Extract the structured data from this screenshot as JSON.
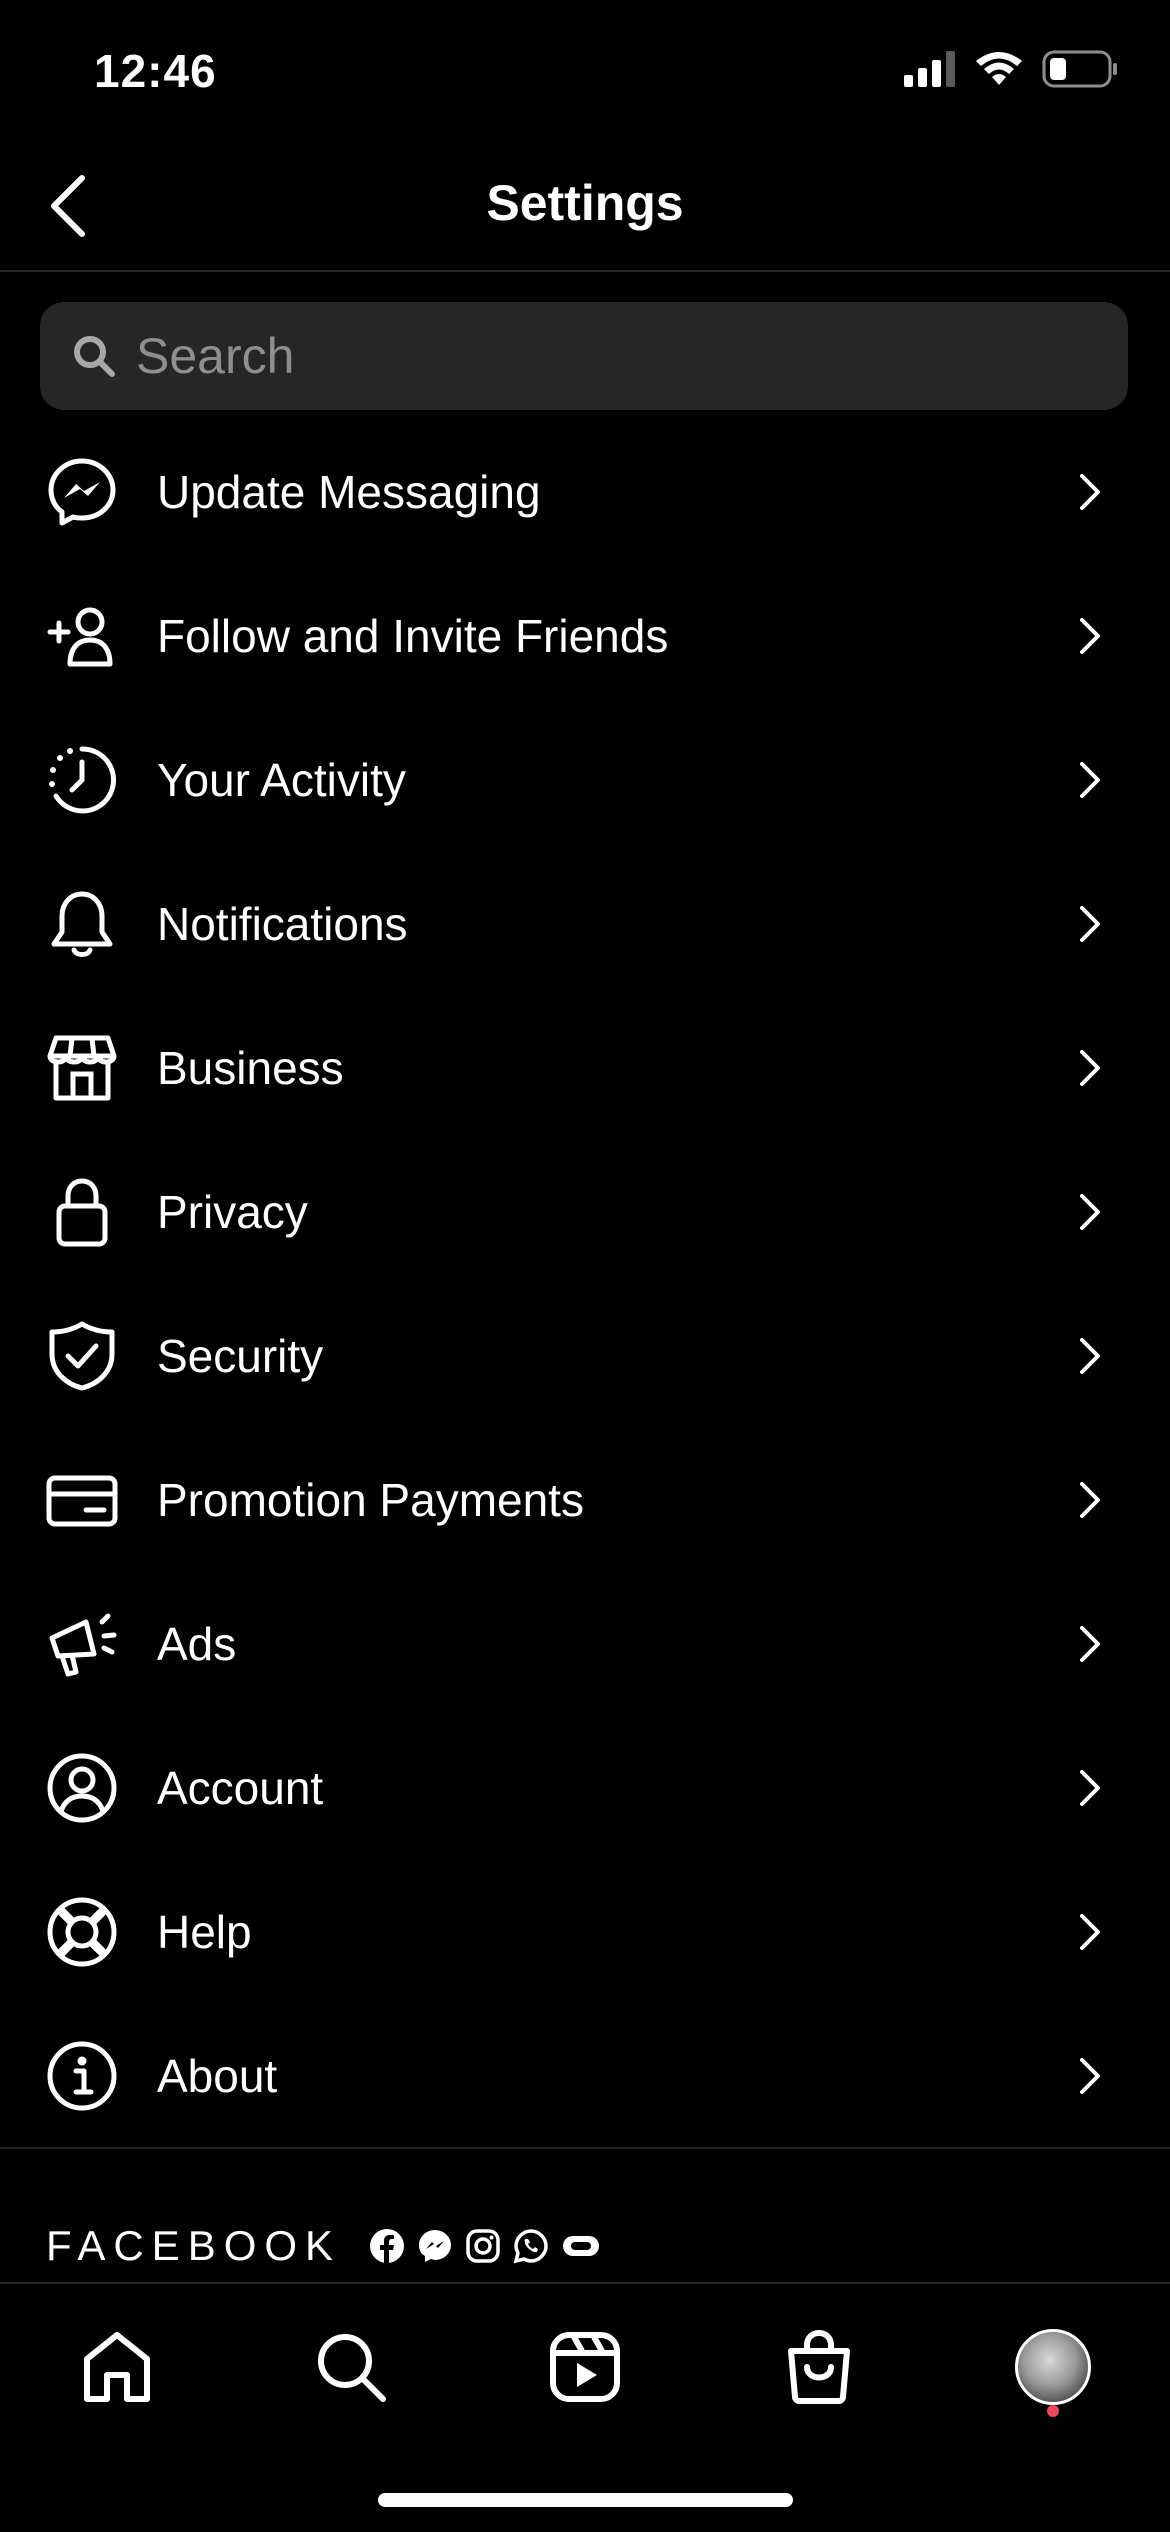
{
  "status_bar": {
    "time": "12:46",
    "icons": [
      "cellular-signal-icon",
      "wifi-icon",
      "battery-icon"
    ]
  },
  "header": {
    "title": "Settings",
    "back_icon": "chevron-left-icon"
  },
  "search": {
    "placeholder": "Search",
    "value": "",
    "icon": "search-icon"
  },
  "menu": {
    "items": [
      {
        "label": "Update Messaging",
        "icon": "messenger-icon"
      },
      {
        "label": "Follow and Invite Friends",
        "icon": "add-person-icon"
      },
      {
        "label": "Your Activity",
        "icon": "activity-clock-icon"
      },
      {
        "label": "Notifications",
        "icon": "bell-icon"
      },
      {
        "label": "Business",
        "icon": "storefront-icon"
      },
      {
        "label": "Privacy",
        "icon": "lock-icon"
      },
      {
        "label": "Security",
        "icon": "shield-check-icon"
      },
      {
        "label": "Promotion Payments",
        "icon": "credit-card-icon"
      },
      {
        "label": "Ads",
        "icon": "megaphone-icon"
      },
      {
        "label": "Account",
        "icon": "user-circle-icon"
      },
      {
        "label": "Help",
        "icon": "lifebuoy-icon"
      },
      {
        "label": "About",
        "icon": "info-icon"
      }
    ]
  },
  "footer": {
    "brand": "FACEBOOK",
    "app_icons": [
      "facebook-icon",
      "messenger-icon",
      "instagram-icon",
      "whatsapp-icon",
      "portal-icon"
    ]
  },
  "tab_bar": {
    "tabs": [
      "home-icon",
      "search-icon",
      "reels-icon",
      "shop-icon",
      "profile-avatar"
    ],
    "profile_has_notification": true
  },
  "colors": {
    "background": "#000000",
    "text": "#ffffff",
    "secondary_text": "#8e8e8e",
    "search_background": "#262626",
    "divider": "#262626",
    "notification_dot": "#ed4956"
  }
}
